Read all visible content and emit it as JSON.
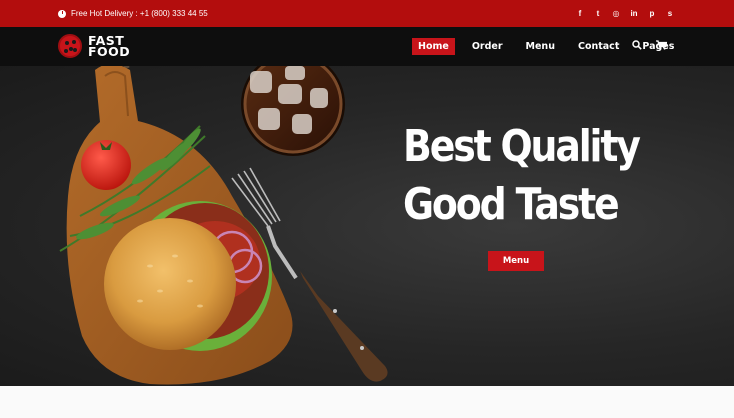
{
  "topbar": {
    "delivery_text": "Free Hot Delivery : +1 (800) 333 44 55",
    "social_icons": [
      "facebook-icon",
      "twitter-icon",
      "instagram-icon",
      "linkedin-icon",
      "pinterest-icon",
      "skype-icon"
    ],
    "social_glyphs": [
      "f",
      "t",
      "◎",
      "in",
      "p",
      "s"
    ]
  },
  "brand": {
    "line1": "FAST",
    "line2": "FOOD"
  },
  "nav": {
    "items": [
      {
        "label": "Home",
        "active": true
      },
      {
        "label": "Order",
        "active": false
      },
      {
        "label": "Menu",
        "active": false
      },
      {
        "label": "Contact",
        "active": false
      },
      {
        "label": "Pages",
        "active": false
      }
    ],
    "icons": [
      "search-icon",
      "cart-icon"
    ]
  },
  "hero": {
    "title_line1": "Best Quality",
    "title_line2": "Good Taste",
    "button_label": "Menu"
  },
  "colors": {
    "accent": "#c8141a",
    "topbar": "#b30d0d",
    "navbar": "#0e0e0e"
  }
}
